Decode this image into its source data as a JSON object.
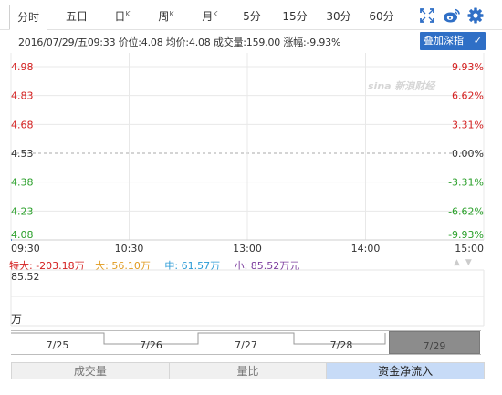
{
  "tabs": [
    {
      "label": "分时",
      "sup": "",
      "active": true
    },
    {
      "label": "五日",
      "sup": "",
      "active": false
    },
    {
      "label": "日",
      "sup": "K",
      "active": false
    },
    {
      "label": "周",
      "sup": "K",
      "active": false
    },
    {
      "label": "月",
      "sup": "K",
      "active": false
    },
    {
      "label": "5分",
      "sup": "",
      "active": false
    },
    {
      "label": "15分",
      "sup": "",
      "active": false
    },
    {
      "label": "30分",
      "sup": "",
      "active": false
    },
    {
      "label": "60分",
      "sup": "",
      "active": false
    }
  ],
  "toolbar": {
    "fullscreen_icon": "fullscreen-icon",
    "weibo_icon": "weibo-icon",
    "settings_icon": "gear-icon"
  },
  "info": {
    "line": "2016/07/29/五09:33 价位:4.08 均价:4.08 成交量:159.00 涨幅:-9.93%"
  },
  "overlay": {
    "label": "叠加深指",
    "check": "✓"
  },
  "logo_text": "sina 新浪财经",
  "chart_data": {
    "type": "line",
    "y_left_labels": [
      "4.98",
      "4.83",
      "4.68",
      "4.53",
      "4.38",
      "4.23",
      "4.08"
    ],
    "y_right_labels": [
      "9.93%",
      "6.62%",
      "3.31%",
      "0.00%",
      "-3.31%",
      "-6.62%",
      "-9.93%"
    ],
    "x_labels": [
      "09:30",
      "10:30",
      "13:00",
      "14:00",
      "15:00"
    ],
    "ylim": [
      4.08,
      4.98
    ],
    "prev_close": 4.53,
    "series": [
      {
        "values": [
          4.08
        ]
      }
    ],
    "colors": {
      "up": "#d42020",
      "flat": "#333333",
      "down": "#2ba02b"
    }
  },
  "legend": {
    "super_large": "特大: -203.18万",
    "large": "大: 56.10万",
    "medium": "中: 61.57万",
    "small": "小: 85.52万元",
    "colors": {
      "super_large": "#d42020",
      "large": "#e09a1e",
      "medium": "#2a9ad6",
      "small": "#7b3c9d"
    }
  },
  "volume": {
    "value": "85.52",
    "unit": "万"
  },
  "dates": [
    {
      "label": "7/25",
      "selected": false
    },
    {
      "label": "7/26",
      "selected": false
    },
    {
      "label": "7/27",
      "selected": false
    },
    {
      "label": "7/28",
      "selected": false
    },
    {
      "label": "7/29",
      "selected": true
    }
  ],
  "bottom_tabs": [
    {
      "label": "成交量",
      "active": false
    },
    {
      "label": "量比",
      "active": false
    },
    {
      "label": "资金净流入",
      "active": true
    }
  ]
}
